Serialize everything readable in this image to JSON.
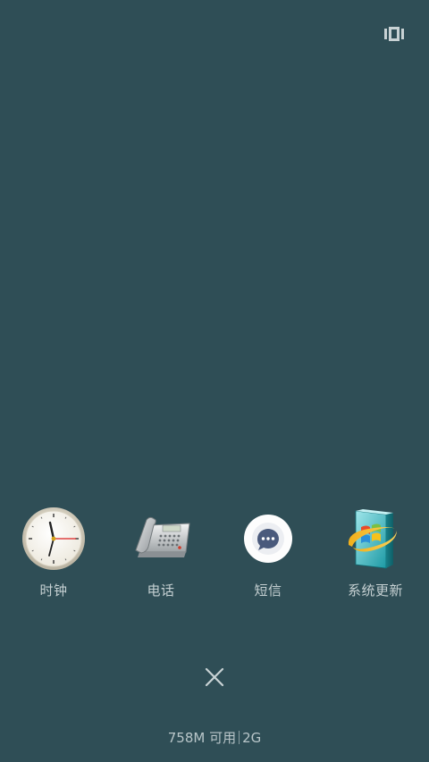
{
  "top_bar": {
    "layout_toggle_icon": "card-view-icon"
  },
  "recent_apps": [
    {
      "label": "时钟",
      "icon": "clock-icon"
    },
    {
      "label": "电话",
      "icon": "telephone-icon"
    },
    {
      "label": "短信",
      "icon": "message-bubble-icon"
    },
    {
      "label": "系统更新",
      "icon": "system-update-icon"
    }
  ],
  "clear_all": {
    "icon": "close-icon"
  },
  "memory": {
    "available": "758M 可用",
    "total": "2G"
  },
  "colors": {
    "background": "#2f4e56",
    "label_text": "#c5d0d2"
  }
}
